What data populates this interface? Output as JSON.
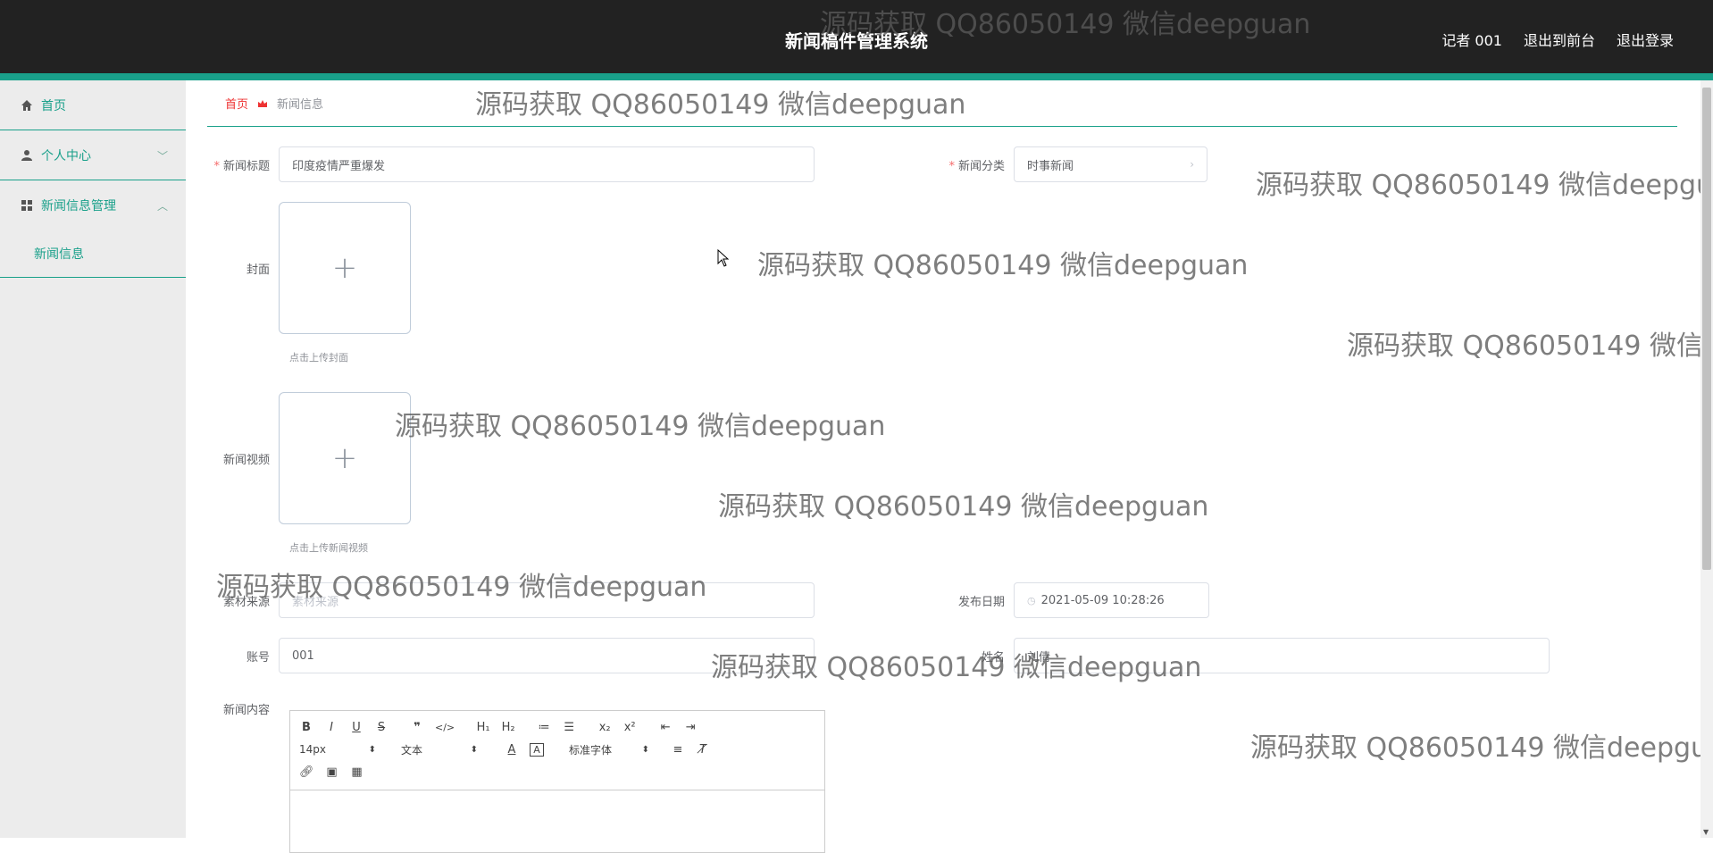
{
  "header": {
    "title": "新闻稿件管理系统",
    "links": [
      "记者 001",
      "退出到前台",
      "退出登录"
    ],
    "bg_color": "#222222",
    "accent_color": "#19a08a"
  },
  "sidebar": {
    "items": [
      {
        "label": "首页",
        "icon": "home-icon"
      },
      {
        "label": "个人中心",
        "icon": "user-icon"
      },
      {
        "label": "新闻信息管理",
        "icon": "grid-icon",
        "children": [
          "新闻信息"
        ]
      }
    ]
  },
  "breadcrumb": {
    "home": "首页",
    "current": "新闻信息"
  },
  "form": {
    "title_label": "新闻标题",
    "title_value": "印度疫情严重爆发",
    "category_label": "新闻分类",
    "category_value": "时事新闻",
    "cover_label": "封面",
    "cover_tip": "点击上传封面",
    "video_label": "新闻视频",
    "video_tip": "点击上传新闻视频",
    "source_label": "素材来源",
    "source_placeholder": "素材来源",
    "date_label": "发布日期",
    "date_value": "2021-05-09 10:28:26",
    "account_label": "账号",
    "account_value": "001",
    "name_label": "姓名",
    "name_value": "刘倩",
    "content_label": "新闻内容"
  },
  "editor": {
    "font_size": "14px",
    "paragraph": "文本",
    "font_family": "标准字体"
  },
  "watermark": "源码获取 QQ86050149 微信deepguan"
}
